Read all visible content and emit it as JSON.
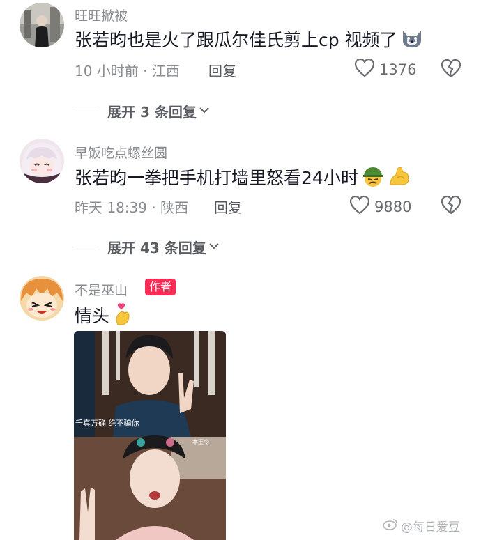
{
  "comments": [
    {
      "username": "旺旺掀被",
      "content": "张若昀也是火了跟瓜尔佳氏剪上cp 视频了",
      "meta": "10 小时前 · 江西",
      "reply_label": "回复",
      "likes": "1376",
      "expand_label": "展开 3 条回复",
      "emoji_icon": "wolf-emoji-icon"
    },
    {
      "username": "早饭吃点螺丝圆",
      "content": "张若昀一拳把手机打墙里怒看24小时",
      "meta": "昨天 18:39 · 陕西",
      "reply_label": "回复",
      "likes": "9880",
      "expand_label": "展开 43 条回复",
      "emoji_icons": [
        "soldier-helmet-emoji-icon",
        "flexed-bicep-emoji-icon"
      ]
    },
    {
      "username": "不是巫山",
      "badge": "作者",
      "content": "情头",
      "emoji_icon": "finger-heart-emoji-icon",
      "image_captions": [
        "千真万确 绝不骗你",
        "本王令"
      ]
    }
  ],
  "watermark": "@每日爱豆",
  "colors": {
    "accent": "#fe2c55",
    "secondary_text": "#8a8b91",
    "primary_text": "#161823"
  }
}
